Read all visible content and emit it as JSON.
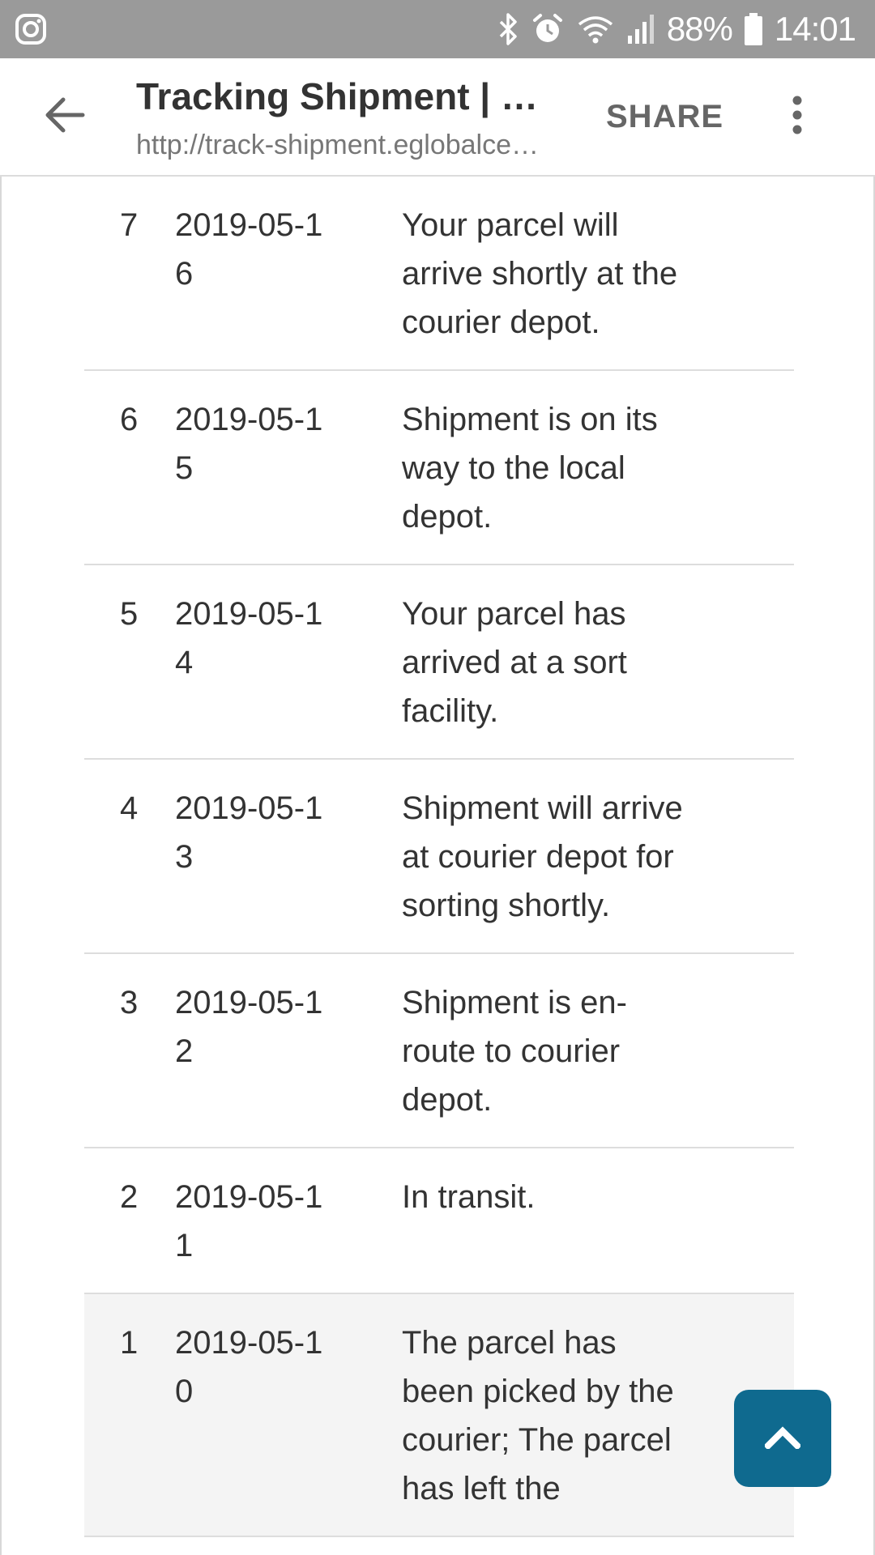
{
  "status_bar": {
    "left_icon": "instagram-icon",
    "icons": [
      "bluetooth-icon",
      "alarm-icon",
      "wifi-icon",
      "signal-icon"
    ],
    "battery": "88%",
    "battery_icon": "battery-icon",
    "time": "14:01"
  },
  "toolbar": {
    "back_icon": "arrow-left-icon",
    "title": "Tracking Shipment | eG…",
    "url": "http://track-shipment.eglobalce…",
    "share_label": "SHARE",
    "menu_icon": "more-vert-icon"
  },
  "tracking": {
    "rows": [
      {
        "num": "7",
        "date": "2019-05-16",
        "status": "Your parcel will arrive shortly at the courier depot."
      },
      {
        "num": "6",
        "date": "2019-05-15",
        "status": "Shipment is on its way to the local depot."
      },
      {
        "num": "5",
        "date": "2019-05-14",
        "status": "Your parcel has arrived at a sort facility."
      },
      {
        "num": "4",
        "date": "2019-05-13",
        "status": "Shipment will arrive at courier depot for sorting shortly."
      },
      {
        "num": "3",
        "date": "2019-05-12",
        "status": "Shipment is en-route to courier depot."
      },
      {
        "num": "2",
        "date": "2019-05-11",
        "status": "In transit."
      },
      {
        "num": "1",
        "date": "2019-05-10",
        "status": "The parcel has been picked by the courier; The parcel has left the"
      }
    ]
  },
  "scroll_top": {
    "icon": "chevron-up-icon"
  },
  "colors": {
    "status_bar_bg": "#9a9a9a",
    "scroll_top_bg": "#0f6a8f",
    "highlight_row_bg": "#f4f4f4",
    "text": "#333333"
  }
}
